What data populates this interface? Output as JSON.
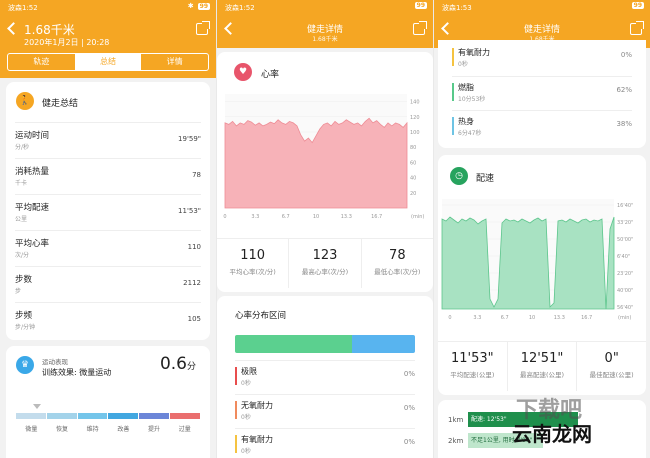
{
  "status_bar": {
    "carrier": "波森1:52",
    "carrier_p2": "波森1:52",
    "carrier_p3": "波森1:53",
    "battery": "99"
  },
  "panel1": {
    "title": "1.68千米",
    "subtitle": "2020年1月2日 | 20:28",
    "tabs": [
      "轨迹",
      "总结",
      "详情"
    ],
    "section_title": "健走总结",
    "rows": [
      {
        "label": "运动时间",
        "unit": "分/秒",
        "value": "19'59\""
      },
      {
        "label": "消耗热量",
        "unit": "千卡",
        "value": "78"
      },
      {
        "label": "平均配速",
        "unit": "公里",
        "value": "11'53\""
      },
      {
        "label": "平均心率",
        "unit": "次/分",
        "value": "110"
      },
      {
        "label": "步数",
        "unit": "步",
        "value": "2112"
      },
      {
        "label": "步频",
        "unit": "步/分钟",
        "value": "105"
      }
    ],
    "performance": {
      "title": "运动表现",
      "effect": "训练效果: 微量运动",
      "score": "0.6",
      "score_unit": "分",
      "scale": [
        "微量",
        "恢复",
        "维持",
        "改善",
        "提升",
        "过量"
      ],
      "scale_colors": [
        "#c3dcec",
        "#a3d3ea",
        "#74c5ea",
        "#42a7e0",
        "#6c86d8",
        "#ea6e6e"
      ]
    }
  },
  "panel2": {
    "title": "健走详情",
    "subtitle": "1.68千米",
    "heart_title": "心率",
    "y_ticks": [
      "140",
      "120",
      "100",
      "80",
      "60",
      "40",
      "20"
    ],
    "x_ticks": [
      "0",
      "3.3",
      "6.7",
      "10",
      "13.3",
      "16.7"
    ],
    "x_unit": "(min)",
    "stats": [
      {
        "value": "110",
        "label": "平均心率(次/分)"
      },
      {
        "value": "123",
        "label": "最高心率(次/分)"
      },
      {
        "value": "78",
        "label": "最低心率(次/分)"
      }
    ],
    "zones_title": "心率分布区间",
    "zones": [
      {
        "name": "极限",
        "dur": "0秒",
        "pct": "0%",
        "color": "#e84d4d"
      },
      {
        "name": "无氧耐力",
        "dur": "0秒",
        "pct": "0%",
        "color": "#f08a5d"
      },
      {
        "name": "有氧耐力",
        "dur": "0秒",
        "pct": "0%",
        "color": "#f5c341"
      }
    ]
  },
  "panel3": {
    "title": "健走详情",
    "subtitle": "1.68千米",
    "zones": [
      {
        "name": "有氧耐力",
        "dur": "0秒",
        "pct": "0%",
        "color": "#f5c341"
      },
      {
        "name": "燃脂",
        "dur": "10分53秒",
        "pct": "62%",
        "color": "#58c98a"
      },
      {
        "name": "热身",
        "dur": "6分47秒",
        "pct": "38%",
        "color": "#6ec4e4"
      }
    ],
    "pace_title": "配速",
    "y_ticks": [
      "16'40\"",
      "33'20\"",
      "50'00\"",
      "6'40\"",
      "23'20\"",
      "40'00\"",
      "56'40\""
    ],
    "x_ticks": [
      "0",
      "3.3",
      "6.7",
      "10",
      "13.3",
      "16.7"
    ],
    "x_unit": "(min)",
    "stats": [
      {
        "value": "11'53\"",
        "label": "平均配速(公里)"
      },
      {
        "value": "12'51\"",
        "label": "最高配速(公里)"
      },
      {
        "value": "0\"",
        "label": "最佳配速(公里)"
      }
    ],
    "splits": [
      {
        "km": "1km",
        "label": "配速: 12'53\""
      },
      {
        "km": "2km",
        "label": "不足1公里, 用时 7'06\""
      }
    ]
  },
  "watermark": {
    "text1": "下载吧",
    "text2": "云南龙网"
  }
}
